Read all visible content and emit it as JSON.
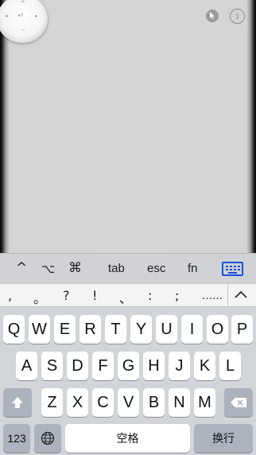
{
  "pad": {
    "dpad_labels": {
      "up": "+",
      "down": "−",
      "left": "◂",
      "right": "▸",
      "center": "▸ll"
    }
  },
  "modbar": {
    "ctrl": "^",
    "opt": "⌥",
    "cmd": "⌘",
    "tab": "tab",
    "esc": "esc",
    "fn": "fn",
    "accent": "#1a4fd6"
  },
  "punctuation": [
    ",",
    "。",
    "?",
    "!",
    "、",
    ":",
    ";",
    "……"
  ],
  "keyboard": {
    "row1": [
      "Q",
      "W",
      "E",
      "R",
      "T",
      "Y",
      "U",
      "I",
      "O",
      "P"
    ],
    "row2": [
      "A",
      "S",
      "D",
      "F",
      "G",
      "H",
      "J",
      "K",
      "L"
    ],
    "row3": [
      "Z",
      "X",
      "C",
      "V",
      "B",
      "N",
      "M"
    ],
    "numbers_label": "123",
    "space_label": "空格",
    "return_label": "换行"
  }
}
